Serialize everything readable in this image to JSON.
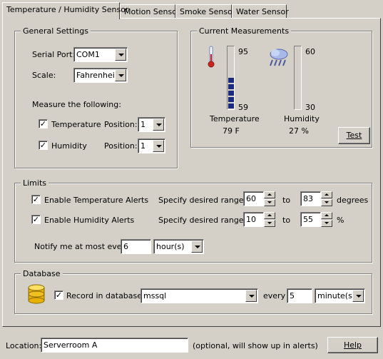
{
  "tabs": [
    {
      "label": "Temperature / Humidity Sensor"
    },
    {
      "label": "Motion Sensor"
    },
    {
      "label": "Smoke Sensor"
    },
    {
      "label": "Water Sensor"
    }
  ],
  "general": {
    "title": "General Settings",
    "serial_port_label": "Serial Port:",
    "serial_port_value": "COM1",
    "scale_label": "Scale:",
    "scale_value": "Fahrenheit",
    "measure_label": "Measure the following:",
    "temperature_label": "Temperature",
    "temperature_checked": true,
    "temperature_position_label": "Position:",
    "temperature_position": "1",
    "humidity_label": "Humidity",
    "humidity_checked": true,
    "humidity_position_label": "Position:",
    "humidity_position": "1"
  },
  "measurements": {
    "title": "Current Measurements",
    "temp_max": "95",
    "temp_min": "59",
    "temp_label": "Temperature",
    "temp_value": "79 F",
    "temp_level": 0.56,
    "hum_max": "60",
    "hum_min": "30",
    "hum_label": "Humidity",
    "hum_value": "27 %",
    "hum_level": 0,
    "test_label": "Test",
    "thermometer_icon": "thermometer-icon",
    "humidity_icon": "rain-cloud-icon"
  },
  "limits": {
    "title": "Limits",
    "temp_alert_label": "Enable Temperature Alerts",
    "temp_alert_checked": true,
    "temp_range_label": "Specify desired range:",
    "temp_low": "60",
    "temp_to": "to",
    "temp_high": "83",
    "temp_unit": "degrees",
    "hum_alert_label": "Enable Humidity Alerts",
    "hum_alert_checked": true,
    "hum_range_label": "Specify desired range:",
    "hum_low": "10",
    "hum_to": "to",
    "hum_high": "55",
    "hum_unit": "%",
    "notify_label": "Notify me at most every",
    "notify_value": "6",
    "notify_unit": "hour(s)"
  },
  "database": {
    "title": "Database",
    "icon": "database-icon",
    "record_label": "Record in database:",
    "record_checked": true,
    "db_value": "mssql",
    "every_label": "every",
    "every_value": "5",
    "every_unit": "minute(s)"
  },
  "footer": {
    "location_label": "Location:",
    "location_value": "Serverroom A",
    "location_hint": "(optional, will show up in alerts)",
    "help_label": "Help"
  },
  "colors": {
    "window_bg": "#d4d0c8",
    "gauge_fill": "#1a2a80"
  }
}
